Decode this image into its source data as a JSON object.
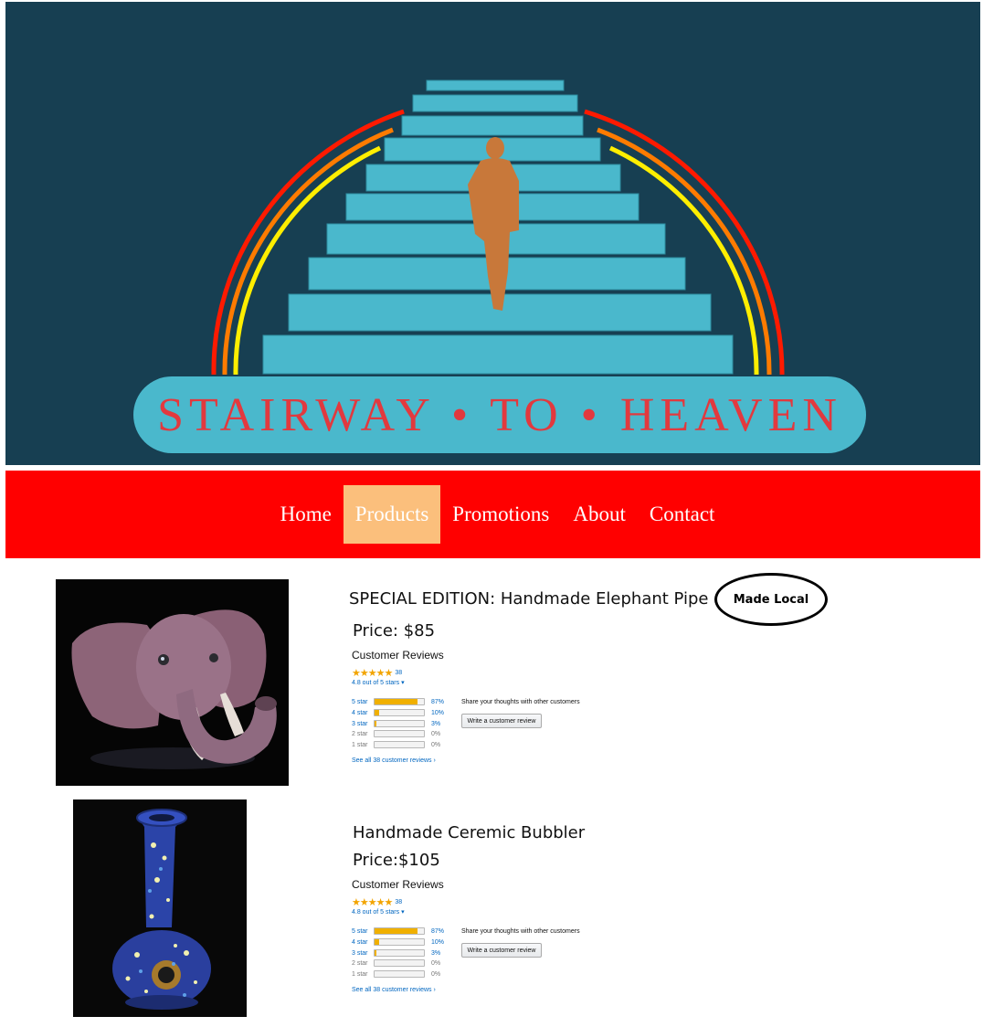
{
  "brand": {
    "title": "STAIRWAY • TO • HEAVEN"
  },
  "nav": {
    "items": [
      {
        "label": "Home",
        "active": false
      },
      {
        "label": "Products",
        "active": true
      },
      {
        "label": "Promotions",
        "active": false
      },
      {
        "label": "About",
        "active": false
      },
      {
        "label": "Contact",
        "active": false
      }
    ]
  },
  "colors": {
    "banner_bg": "#173f52",
    "nav_bg": "#ff0000",
    "nav_active": "#fbbf7c",
    "stairs": "#4ab8cc",
    "figure": "#c8783a",
    "star": "#f0b000"
  },
  "products": [
    {
      "title": "SPECIAL EDITION: Handmade Elephant Pipe",
      "badge": "Made Local",
      "price": "Price: $85",
      "image": "elephant-pipe-photo",
      "reviews": {
        "heading": "Customer Reviews",
        "stars": "★★★★★",
        "count": "38",
        "average": "4.8 out of 5 stars ▾",
        "histogram": [
          {
            "label": "5 star",
            "percent": "87%",
            "value": 87
          },
          {
            "label": "4 star",
            "percent": "10%",
            "value": 10
          },
          {
            "label": "3 star",
            "percent": "3%",
            "value": 3
          },
          {
            "label": "2 star",
            "percent": "0%",
            "value": 0
          },
          {
            "label": "1 star",
            "percent": "0%",
            "value": 0
          }
        ],
        "see_all": "See all 38 customer reviews ›",
        "share": "Share your thoughts with other customers",
        "write_button": "Write a customer review"
      }
    },
    {
      "title": "Handmade Ceremic Bubbler",
      "price": "Price:$105",
      "image": "ceramic-bubbler-photo",
      "reviews": {
        "heading": "Customer Reviews",
        "stars": "★★★★★",
        "count": "38",
        "average": "4.8 out of 5 stars ▾",
        "histogram": [
          {
            "label": "5 star",
            "percent": "87%",
            "value": 87
          },
          {
            "label": "4 star",
            "percent": "10%",
            "value": 10
          },
          {
            "label": "3 star",
            "percent": "3%",
            "value": 3
          },
          {
            "label": "2 star",
            "percent": "0%",
            "value": 0
          },
          {
            "label": "1 star",
            "percent": "0%",
            "value": 0
          }
        ],
        "see_all": "See all 38 customer reviews ›",
        "share": "Share your thoughts with other customers",
        "write_button": "Write a customer review"
      }
    }
  ]
}
